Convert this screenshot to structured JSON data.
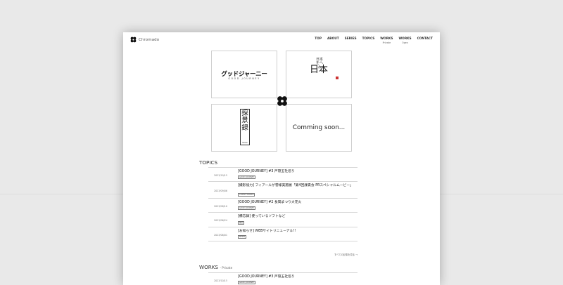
{
  "brand": {
    "name": "Chromado"
  },
  "nav": [
    {
      "label": "TOP"
    },
    {
      "label": "ABOUT"
    },
    {
      "label": "SERIES"
    },
    {
      "label": "TOPICS"
    },
    {
      "label": "WORKS",
      "sub": "Private"
    },
    {
      "label": "WORKS",
      "sub": "Open"
    },
    {
      "label": "CONTACT"
    }
  ],
  "tiles": {
    "good_journey": {
      "main": "グッドジャーニー",
      "sub": "GOOD JOURNEY"
    },
    "nihon": {
      "small": "日本をへん",
      "big": "日本"
    },
    "saikei": {
      "main": "採景録",
      "sub": "Saikei"
    },
    "coming": {
      "text": "Comming soon..."
    }
  },
  "topics": {
    "title": "TOPICS",
    "items": [
      {
        "date": "2023/10/15",
        "title": "[GOOD JOURNEY] #3 戸隠五社巡り",
        "tag": "GOOD JOURNEY"
      },
      {
        "date": "2023/09/06",
        "title": "[撮影協力] フィアールが菅様実施展「第4回課責会 PRスペシャルムービー」",
        "tag": "CLIENT WORKS"
      },
      {
        "date": "2023/08/10",
        "title": "[GOOD JOURNEY] #2 長岡まつり大花火",
        "tag": "GOOD JOURNEY"
      },
      {
        "date": "2023/06/24",
        "title": "[備忘録] 使っているソフトなど",
        "tag": "雑記"
      },
      {
        "date": "2023/06/01",
        "title": "[お知らせ] WEBサイトリニューアル!!",
        "tag": "NEWS"
      }
    ],
    "more": "すべての記事を見る →"
  },
  "works": {
    "title": "WORKS",
    "sub": "- Private",
    "items": [
      {
        "date": "2023/10/15",
        "title": "[GOOD JOURNEY] #3 戸隠五社巡り",
        "tag": "GOOD JOURNEY"
      }
    ]
  }
}
